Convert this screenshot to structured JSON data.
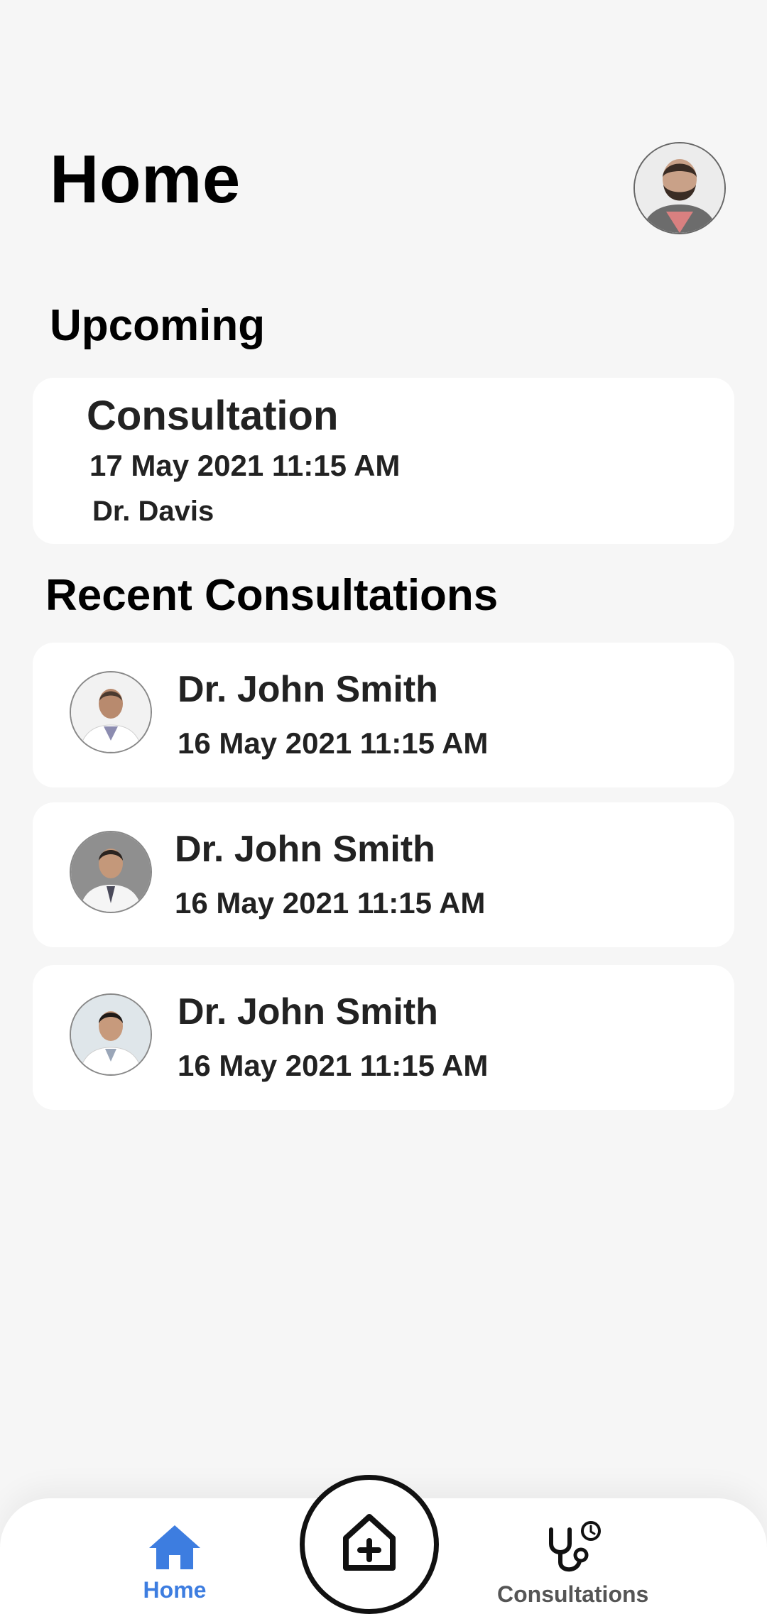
{
  "header": {
    "title": "Home",
    "avatar_icon": "user-avatar"
  },
  "upcoming": {
    "heading": "Upcoming",
    "card": {
      "type": "Consultation",
      "datetime": "17 May 2021  11:15 AM",
      "doctor": "Dr. Davis"
    }
  },
  "recent": {
    "heading": "Recent Consultations",
    "items": [
      {
        "name": "Dr. John Smith",
        "datetime": "16 May 2021  11:15 AM",
        "photo_icon": "doctor-photo"
      },
      {
        "name": "Dr. John Smith",
        "datetime": "16 May 2021  11:15 AM",
        "photo_icon": "doctor-photo"
      },
      {
        "name": "Dr. John Smith",
        "datetime": "16 May 2021  11:15 AM",
        "photo_icon": "doctor-photo"
      }
    ]
  },
  "bottom_nav": {
    "home_label": "Home",
    "consultations_label": "Consultations",
    "active_color": "#3d7de0",
    "inactive_color": "#555555",
    "fab_icon": "add-hospital-icon"
  }
}
